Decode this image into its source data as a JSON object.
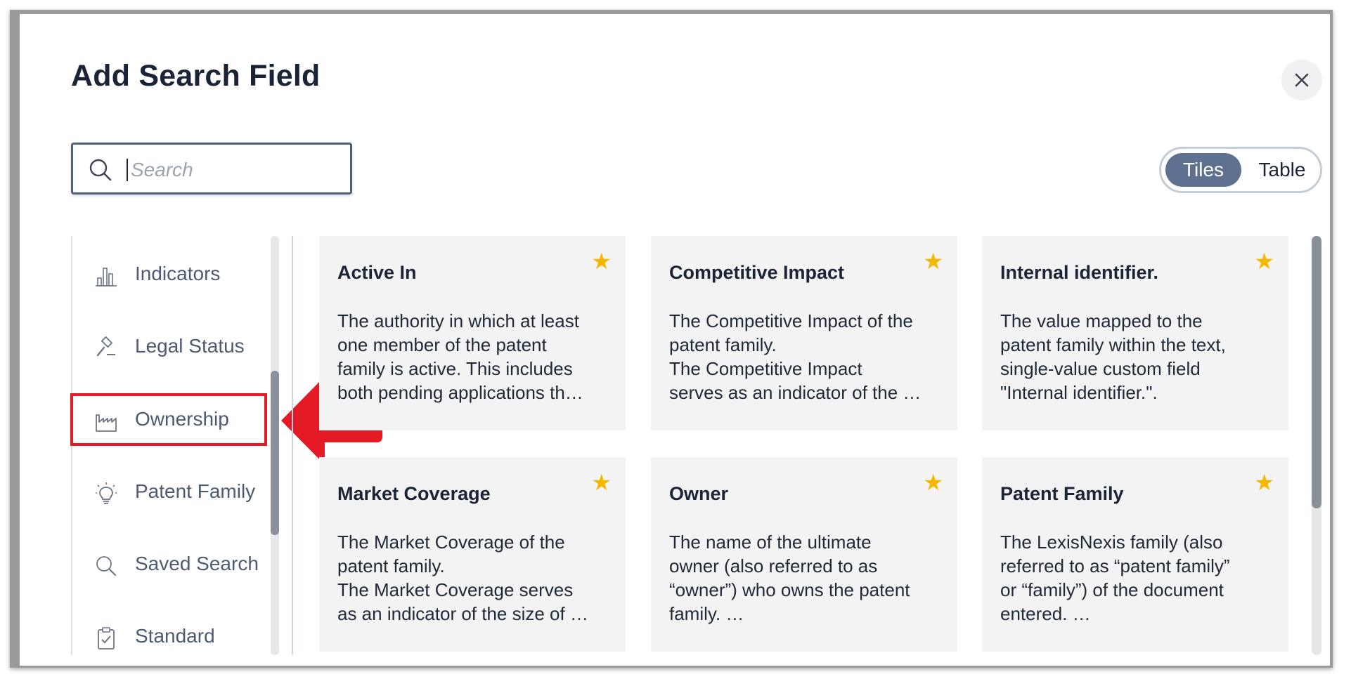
{
  "dialog": {
    "title": "Add Search Field",
    "close_icon": "close-icon"
  },
  "search": {
    "placeholder": "Search",
    "value": "",
    "icon": "search-icon"
  },
  "view_toggle": {
    "options": [
      "Tiles",
      "Table"
    ],
    "selected": "Tiles"
  },
  "sidebar": {
    "items": [
      {
        "label": "Indicators",
        "icon": "bar-chart-icon"
      },
      {
        "label": "Legal Status",
        "icon": "gavel-icon"
      },
      {
        "label": "Ownership",
        "icon": "factory-icon",
        "highlighted": true
      },
      {
        "label": "Patent Family",
        "icon": "lightbulb-icon"
      },
      {
        "label": "Saved Search",
        "icon": "search-icon"
      },
      {
        "label": "Standard",
        "icon": "clipboard-check-icon"
      }
    ]
  },
  "tiles": [
    {
      "title": "Active In",
      "description": "The authority in which at least\none member of the patent\nfamily is active. This includes\nboth pending applications th…",
      "favorite": true
    },
    {
      "title": "Competitive Impact",
      "description": "The Competitive Impact of the\npatent family.\nThe Competitive Impact\nserves as an indicator of the …",
      "favorite": true
    },
    {
      "title": "Internal identifier.",
      "description": "The value mapped to the\npatent family within the text,\nsingle-value custom field\n\"Internal identifier.\".",
      "favorite": true
    },
    {
      "title": "Market Coverage",
      "description": "The Market Coverage of the\npatent family.\nThe Market Coverage serves\nas an indicator of the size of …",
      "favorite": true
    },
    {
      "title": "Owner",
      "description": "The name of the ultimate\nowner (also referred to as\n“owner”) who owns the patent\nfamily. …",
      "favorite": true
    },
    {
      "title": "Patent Family",
      "description": "The LexisNexis family (also\nreferred to as “patent family”\nor “family”) of the document\nentered. …",
      "favorite": true
    }
  ],
  "star_glyph": "★",
  "colors": {
    "accent": "#5e7190",
    "star": "#f5b800",
    "annotation": "#e41b24",
    "title_text": "#1b2437"
  }
}
